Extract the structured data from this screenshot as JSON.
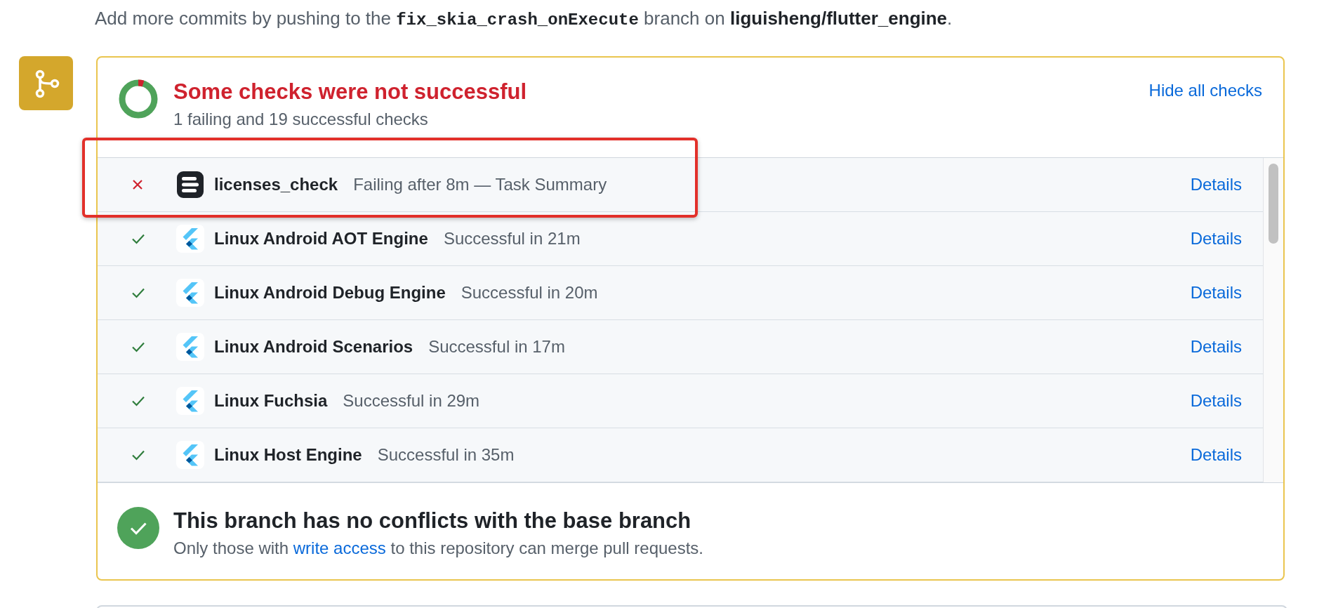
{
  "intro": {
    "before": "Add more commits by pushing to the ",
    "branch": "fix_skia_crash_onExecute",
    "middle": " branch on ",
    "repo": "liguisheng/flutter_engine",
    "after": "."
  },
  "checks_summary": {
    "failed": true,
    "title": "Some checks were not successful",
    "subtitle": "1 failing and 19 successful checks",
    "toggle": "Hide all checks"
  },
  "checks": [
    {
      "failed": true,
      "kind": "task",
      "name": "licenses_check",
      "detail": "Failing after 8m — Task Summary",
      "link": "Details",
      "highlighted": true
    },
    {
      "failed": false,
      "kind": "flutter",
      "name": "Linux Android AOT Engine",
      "detail": "Successful in 21m",
      "link": "Details",
      "highlighted": false
    },
    {
      "failed": false,
      "kind": "flutter",
      "name": "Linux Android Debug Engine",
      "detail": "Successful in 20m",
      "link": "Details",
      "highlighted": false
    },
    {
      "failed": false,
      "kind": "flutter",
      "name": "Linux Android Scenarios",
      "detail": "Successful in 17m",
      "link": "Details",
      "highlighted": false
    },
    {
      "failed": false,
      "kind": "flutter",
      "name": "Linux Fuchsia",
      "detail": "Successful in 29m",
      "link": "Details",
      "highlighted": false
    },
    {
      "failed": false,
      "kind": "flutter",
      "name": "Linux Host Engine",
      "detail": "Successful in 35m",
      "link": "Details",
      "highlighted": false
    }
  ],
  "merge": {
    "has_conflicts": false,
    "title": "This branch has no conflicts with the base branch",
    "before": "Only those with ",
    "link": "write access",
    "after": " to this repository can merge pull requests."
  }
}
